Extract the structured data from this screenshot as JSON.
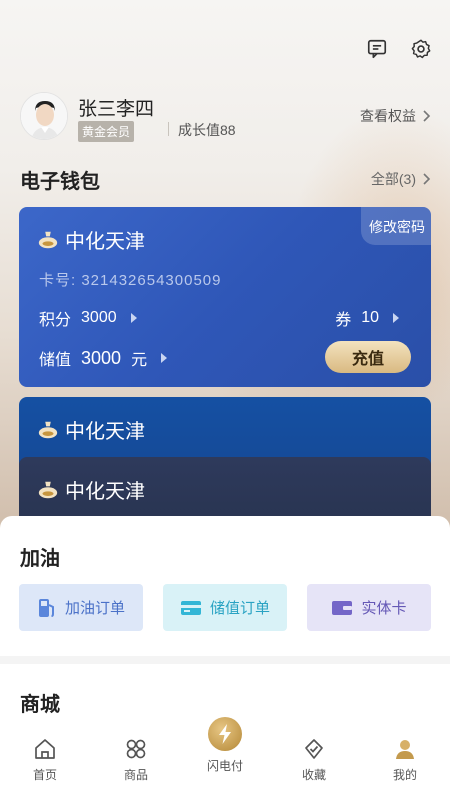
{
  "header": {
    "message_icon": "message-icon",
    "settings_icon": "gear-icon"
  },
  "profile": {
    "name": "张三李四",
    "level_badge": "黄金会员",
    "growth": "成长值88",
    "rights_link": "查看权益"
  },
  "wallet": {
    "title": "电子钱包",
    "all_label": "全部(3)",
    "cards": [
      {
        "brand": "中化天津",
        "modify_password": "修改密码",
        "card_number": "卡号: 321432654300509",
        "points_label": "积分",
        "points_value": "3000",
        "coupon_label": "券",
        "coupon_value": "10",
        "stored_label": "储值",
        "stored_value": "3000",
        "stored_unit": "元",
        "recharge_label": "充值"
      },
      {
        "brand": "中化天津"
      },
      {
        "brand": "中化天津"
      }
    ]
  },
  "refuel": {
    "title": "加油",
    "actions": [
      {
        "label": "加油订单",
        "icon": "fuel-pump-icon"
      },
      {
        "label": "储值订单",
        "icon": "credit-card-icon"
      },
      {
        "label": "实体卡",
        "icon": "wallet-card-icon"
      }
    ]
  },
  "mall": {
    "title": "商城"
  },
  "tabbar": {
    "items": [
      {
        "label": "首页",
        "icon": "home-icon"
      },
      {
        "label": "商品",
        "icon": "products-icon"
      },
      {
        "label": "闪电付",
        "icon": "lightning-icon"
      },
      {
        "label": "收藏",
        "icon": "favorite-icon"
      },
      {
        "label": "我的",
        "icon": "profile-icon"
      }
    ],
    "active_index": 4
  },
  "colors": {
    "card_blue": "#2f57b8",
    "card_navy": "#15458e",
    "card_dark": "#28334f",
    "gold": "#c39a4d",
    "active_tab": "#c39a4d"
  }
}
